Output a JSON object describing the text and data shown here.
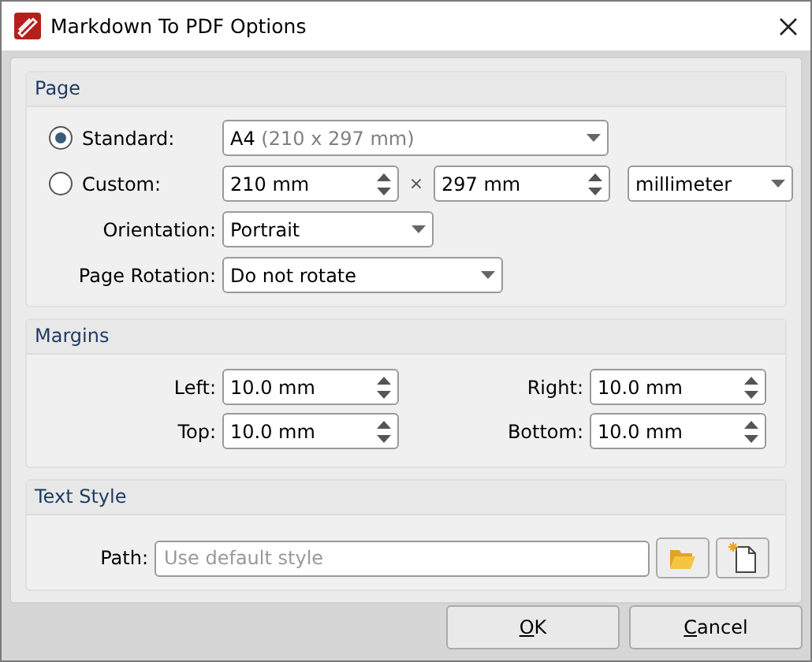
{
  "window": {
    "title": "Markdown To PDF Options"
  },
  "page": {
    "title": "Page",
    "standard": {
      "label": "Standard:",
      "selected": true,
      "size_name": "A4",
      "size_detail": "(210 x 297 mm)"
    },
    "custom": {
      "label": "Custom:",
      "selected": false,
      "width": "210 mm",
      "times": "×",
      "height": "297 mm",
      "unit": "millimeter"
    },
    "orientation": {
      "label": "Orientation:",
      "value": "Portrait"
    },
    "rotation": {
      "label": "Page Rotation:",
      "value": "Do not rotate"
    }
  },
  "margins": {
    "title": "Margins",
    "fields": [
      {
        "label": "Left:",
        "value": "10.0 mm"
      },
      {
        "label": "Right:",
        "value": "10.0 mm"
      },
      {
        "label": "Top:",
        "value": "10.0 mm"
      },
      {
        "label": "Bottom:",
        "value": "10.0 mm"
      }
    ]
  },
  "text_style": {
    "title": "Text Style",
    "path": {
      "label": "Path:",
      "placeholder": "Use default style"
    }
  },
  "buttons": [
    {
      "access_key": "O",
      "label_rest": "K"
    },
    {
      "access_key": "C",
      "label_rest": "ancel"
    }
  ]
}
